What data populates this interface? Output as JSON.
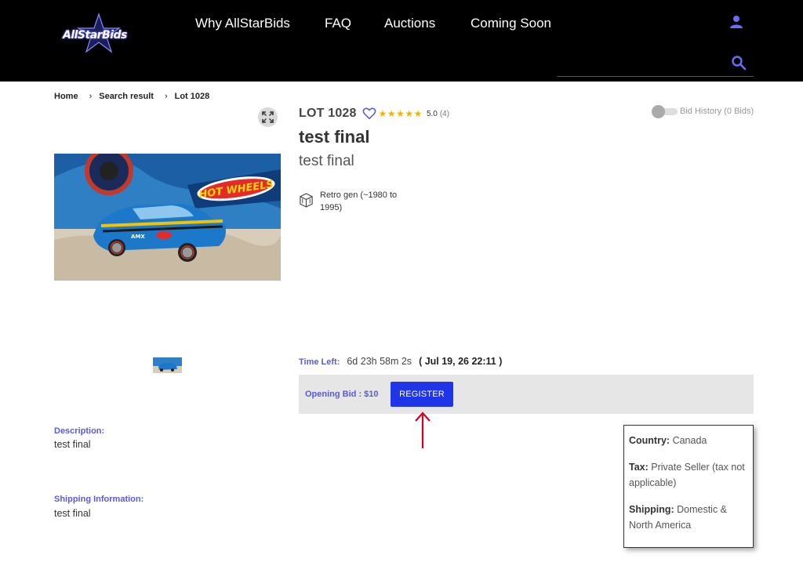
{
  "header": {
    "logo_text": "AllStarBids",
    "nav": [
      "Why AllStarBids",
      "FAQ",
      "Auctions",
      "Coming Soon"
    ],
    "search_placeholder": "",
    "user_icon": "user-icon",
    "search_icon": "search-icon"
  },
  "breadcrumb": [
    "Home",
    "Search result",
    "Lot 1028"
  ],
  "lot": {
    "title": "LOT 1028",
    "stars": "★★★★★",
    "rating": "5.0",
    "rating_count": "(4)",
    "bid_history": "Bid History (0 Bids)",
    "item_title": "test final",
    "item_subtitle": "test final",
    "era": "Retro gen (~1980 to 1995)",
    "time_left_label": "Time Left:",
    "time_left_value": "6d 23h 58m 2s",
    "end_date": "( Jul 19, 26 22:11 )",
    "opening_bid": "Opening Bid : $10",
    "register_label": "REGISTER"
  },
  "description": {
    "label": "Description:",
    "text": "test final"
  },
  "shipping": {
    "label": "Shipping Information:",
    "text": "test final"
  },
  "info_box": {
    "country_label": "Country:",
    "country": "Canada",
    "tax_label": "Tax:",
    "tax": "Private Seller (tax not applicable)",
    "shipping_label": "Shipping:",
    "shipping": "Domestic & North America"
  },
  "colors": {
    "accent": "#5a5adb",
    "register": "#1f35e8",
    "star": "#f0b400",
    "arrow": "#d9001b"
  }
}
